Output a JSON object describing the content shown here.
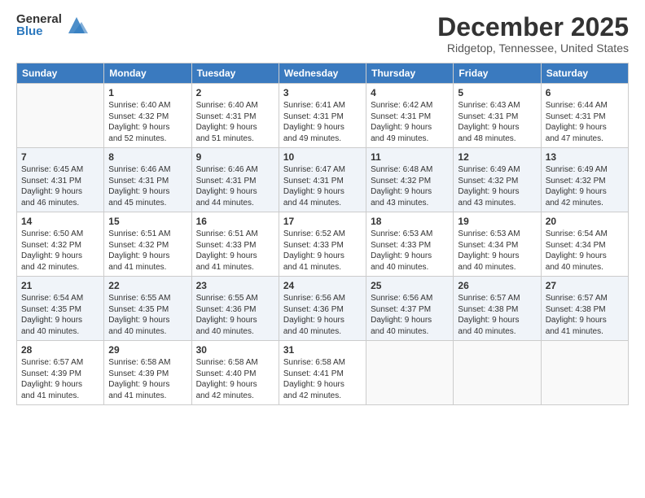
{
  "logo": {
    "general": "General",
    "blue": "Blue"
  },
  "title": "December 2025",
  "subtitle": "Ridgetop, Tennessee, United States",
  "days": [
    "Sunday",
    "Monday",
    "Tuesday",
    "Wednesday",
    "Thursday",
    "Friday",
    "Saturday"
  ],
  "weeks": [
    [
      {
        "date": "",
        "info": ""
      },
      {
        "date": "1",
        "info": "Sunrise: 6:40 AM\nSunset: 4:32 PM\nDaylight: 9 hours\nand 52 minutes."
      },
      {
        "date": "2",
        "info": "Sunrise: 6:40 AM\nSunset: 4:31 PM\nDaylight: 9 hours\nand 51 minutes."
      },
      {
        "date": "3",
        "info": "Sunrise: 6:41 AM\nSunset: 4:31 PM\nDaylight: 9 hours\nand 49 minutes."
      },
      {
        "date": "4",
        "info": "Sunrise: 6:42 AM\nSunset: 4:31 PM\nDaylight: 9 hours\nand 49 minutes."
      },
      {
        "date": "5",
        "info": "Sunrise: 6:43 AM\nSunset: 4:31 PM\nDaylight: 9 hours\nand 48 minutes."
      },
      {
        "date": "6",
        "info": "Sunrise: 6:44 AM\nSunset: 4:31 PM\nDaylight: 9 hours\nand 47 minutes."
      }
    ],
    [
      {
        "date": "7",
        "info": "Sunrise: 6:45 AM\nSunset: 4:31 PM\nDaylight: 9 hours\nand 46 minutes."
      },
      {
        "date": "8",
        "info": "Sunrise: 6:46 AM\nSunset: 4:31 PM\nDaylight: 9 hours\nand 45 minutes."
      },
      {
        "date": "9",
        "info": "Sunrise: 6:46 AM\nSunset: 4:31 PM\nDaylight: 9 hours\nand 44 minutes."
      },
      {
        "date": "10",
        "info": "Sunrise: 6:47 AM\nSunset: 4:31 PM\nDaylight: 9 hours\nand 44 minutes."
      },
      {
        "date": "11",
        "info": "Sunrise: 6:48 AM\nSunset: 4:32 PM\nDaylight: 9 hours\nand 43 minutes."
      },
      {
        "date": "12",
        "info": "Sunrise: 6:49 AM\nSunset: 4:32 PM\nDaylight: 9 hours\nand 43 minutes."
      },
      {
        "date": "13",
        "info": "Sunrise: 6:49 AM\nSunset: 4:32 PM\nDaylight: 9 hours\nand 42 minutes."
      }
    ],
    [
      {
        "date": "14",
        "info": "Sunrise: 6:50 AM\nSunset: 4:32 PM\nDaylight: 9 hours\nand 42 minutes."
      },
      {
        "date": "15",
        "info": "Sunrise: 6:51 AM\nSunset: 4:32 PM\nDaylight: 9 hours\nand 41 minutes."
      },
      {
        "date": "16",
        "info": "Sunrise: 6:51 AM\nSunset: 4:33 PM\nDaylight: 9 hours\nand 41 minutes."
      },
      {
        "date": "17",
        "info": "Sunrise: 6:52 AM\nSunset: 4:33 PM\nDaylight: 9 hours\nand 41 minutes."
      },
      {
        "date": "18",
        "info": "Sunrise: 6:53 AM\nSunset: 4:33 PM\nDaylight: 9 hours\nand 40 minutes."
      },
      {
        "date": "19",
        "info": "Sunrise: 6:53 AM\nSunset: 4:34 PM\nDaylight: 9 hours\nand 40 minutes."
      },
      {
        "date": "20",
        "info": "Sunrise: 6:54 AM\nSunset: 4:34 PM\nDaylight: 9 hours\nand 40 minutes."
      }
    ],
    [
      {
        "date": "21",
        "info": "Sunrise: 6:54 AM\nSunset: 4:35 PM\nDaylight: 9 hours\nand 40 minutes."
      },
      {
        "date": "22",
        "info": "Sunrise: 6:55 AM\nSunset: 4:35 PM\nDaylight: 9 hours\nand 40 minutes."
      },
      {
        "date": "23",
        "info": "Sunrise: 6:55 AM\nSunset: 4:36 PM\nDaylight: 9 hours\nand 40 minutes."
      },
      {
        "date": "24",
        "info": "Sunrise: 6:56 AM\nSunset: 4:36 PM\nDaylight: 9 hours\nand 40 minutes."
      },
      {
        "date": "25",
        "info": "Sunrise: 6:56 AM\nSunset: 4:37 PM\nDaylight: 9 hours\nand 40 minutes."
      },
      {
        "date": "26",
        "info": "Sunrise: 6:57 AM\nSunset: 4:38 PM\nDaylight: 9 hours\nand 40 minutes."
      },
      {
        "date": "27",
        "info": "Sunrise: 6:57 AM\nSunset: 4:38 PM\nDaylight: 9 hours\nand 41 minutes."
      }
    ],
    [
      {
        "date": "28",
        "info": "Sunrise: 6:57 AM\nSunset: 4:39 PM\nDaylight: 9 hours\nand 41 minutes."
      },
      {
        "date": "29",
        "info": "Sunrise: 6:58 AM\nSunset: 4:39 PM\nDaylight: 9 hours\nand 41 minutes."
      },
      {
        "date": "30",
        "info": "Sunrise: 6:58 AM\nSunset: 4:40 PM\nDaylight: 9 hours\nand 42 minutes."
      },
      {
        "date": "31",
        "info": "Sunrise: 6:58 AM\nSunset: 4:41 PM\nDaylight: 9 hours\nand 42 minutes."
      },
      {
        "date": "",
        "info": ""
      },
      {
        "date": "",
        "info": ""
      },
      {
        "date": "",
        "info": ""
      }
    ]
  ]
}
